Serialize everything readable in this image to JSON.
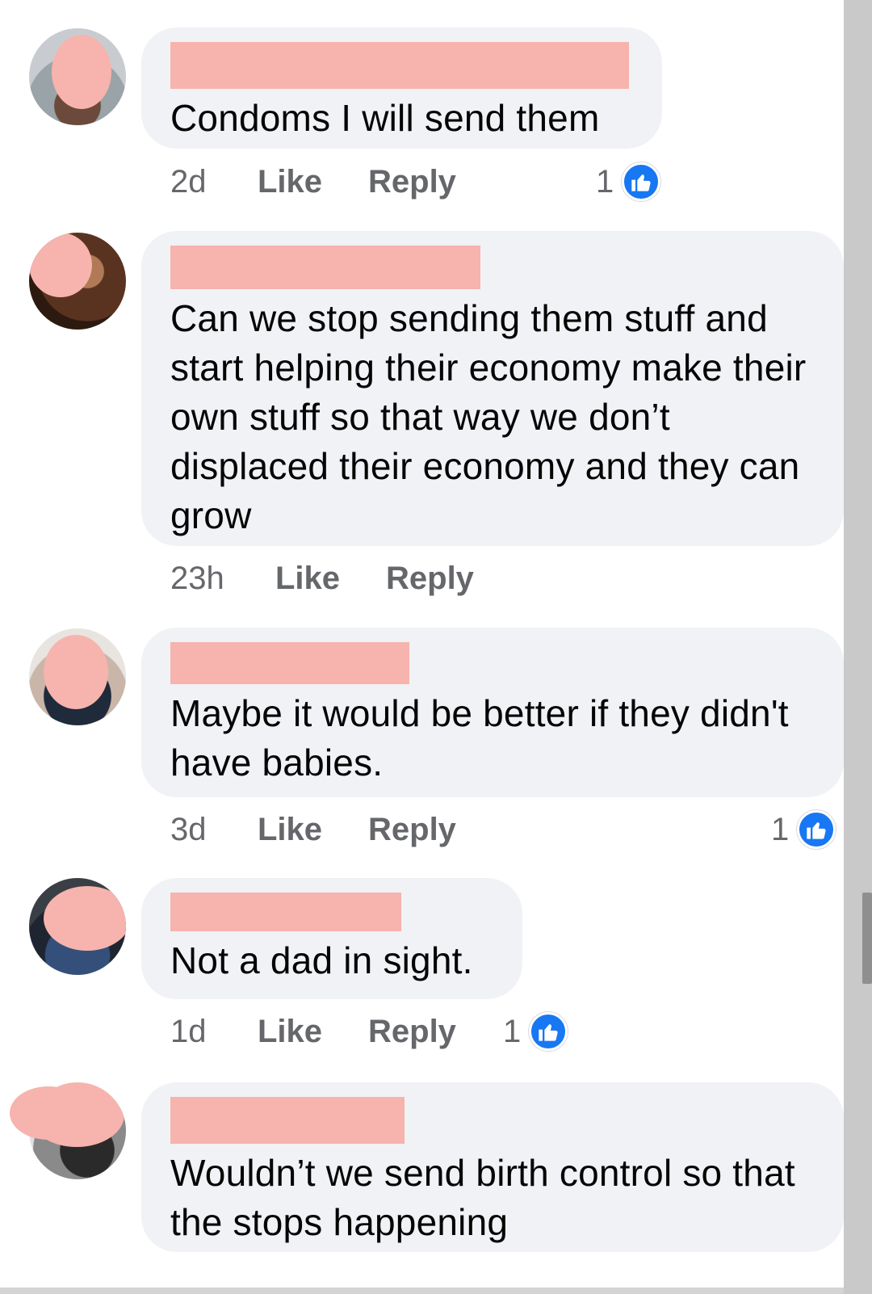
{
  "comments": [
    {
      "text": "Condoms I will send them",
      "time": "2d",
      "like_label": "Like",
      "reply_label": "Reply",
      "reaction_count": "1"
    },
    {
      "text": "Can we stop sending them stuff and start helping their economy make their own stuff so that way we don’t displaced their economy and they can grow",
      "time": "23h",
      "like_label": "Like",
      "reply_label": "Reply"
    },
    {
      "text": "Maybe it would be better if they didn't have babies.",
      "time": "3d",
      "like_label": "Like",
      "reply_label": "Reply",
      "reaction_count": "1"
    },
    {
      "text": "Not a dad in sight.",
      "time": "1d",
      "like_label": "Like",
      "reply_label": "Reply",
      "reaction_count": "1"
    },
    {
      "text": "Wouldn’t we send birth control so that the stops happening"
    }
  ],
  "colors": {
    "bubble": "#f0f2f5",
    "redaction": "#f7b3ad",
    "like_blue": "#1877f2",
    "meta_gray": "#65676b"
  },
  "icons": {
    "reaction": "thumbs-up-icon"
  }
}
